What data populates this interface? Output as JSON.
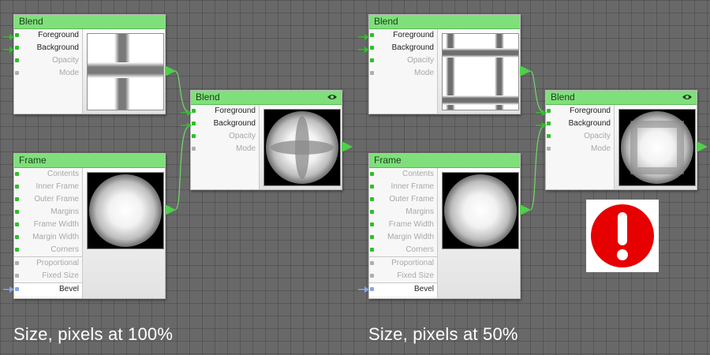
{
  "left_panel": {
    "caption": "Size, pixels at 100%",
    "blend_top": {
      "title": "Blend",
      "ports": [
        "Foreground",
        "Background",
        "Opacity",
        "Mode"
      ]
    },
    "frame": {
      "title": "Frame",
      "ports": [
        "Contents",
        "Inner Frame",
        "Outer Frame",
        "Margins",
        "Frame Width",
        "Margin Width",
        "Corners",
        "Proportional",
        "Fixed Size",
        "Bevel"
      ]
    },
    "blend_result": {
      "title": "Blend",
      "ports": [
        "Foreground",
        "Background",
        "Opacity",
        "Mode"
      ]
    }
  },
  "right_panel": {
    "caption": "Size, pixels at 50%",
    "blend_top": {
      "title": "Blend",
      "ports": [
        "Foreground",
        "Background",
        "Opacity",
        "Mode"
      ]
    },
    "frame": {
      "title": "Frame",
      "ports": [
        "Contents",
        "Inner Frame",
        "Outer Frame",
        "Margins",
        "Frame Width",
        "Margin Width",
        "Corners",
        "Proportional",
        "Fixed Size",
        "Bevel"
      ]
    },
    "blend_result": {
      "title": "Blend",
      "ports": [
        "Foreground",
        "Background",
        "Opacity",
        "Mode"
      ]
    }
  },
  "colors": {
    "node_header": "#7fe07b",
    "port_green": "#2fbf2a",
    "wire": "#6edb69",
    "alert_red": "#e60000"
  },
  "icons": [
    "eye-icon",
    "alert-icon"
  ]
}
